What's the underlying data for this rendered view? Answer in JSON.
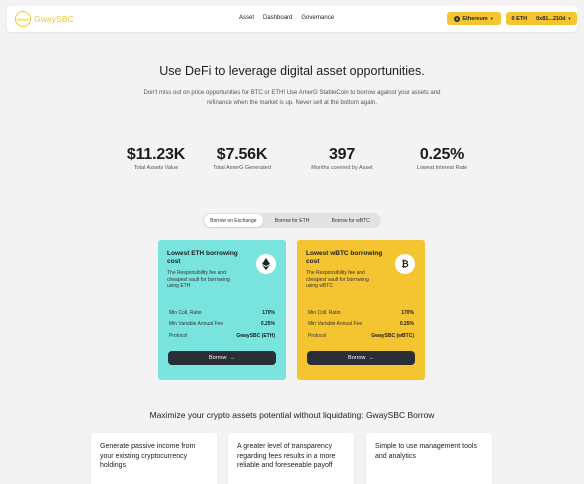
{
  "nav": {
    "logo_text": "GwaySBC",
    "logo_mark": "GWAY",
    "links": [
      "Asset",
      "Dashboard",
      "Governance"
    ],
    "network_label": "Ethereum",
    "balance_label": "0 ETH",
    "address_label": "0x81...210d"
  },
  "hero": {
    "title": "Use DeFi to leverage digital asset opportunities.",
    "subtitle": "Don't miss out on price opportunities for BTC or ETH! Use AmerG StableCoin to borrow against your assets and refinance when the market is up. Never sell at the bottom again."
  },
  "stats": [
    {
      "value": "$11.23K",
      "label": "Total Assets Value"
    },
    {
      "value": "$7.56K",
      "label": "Total AmerG Generated"
    },
    {
      "value": "397",
      "label": "Months covered by Asset"
    },
    {
      "value": "0.25%",
      "label": "Lowest Interest Rate"
    }
  ],
  "tabs": [
    "Borrow on Exchange",
    "Borrow for ETH",
    "Borrow for wBTC"
  ],
  "active_tab": 0,
  "cards": [
    {
      "title": "Lowest ETH borrowing cost",
      "description": "The Responsibility fee and cheapest vault for borrowing using ETH",
      "coin_icon": "ethereum-icon",
      "rows": [
        {
          "label": "Min Coll. Ratio",
          "value": "170%"
        },
        {
          "label": "Min Variable Annual Fee",
          "value": "0.25%"
        },
        {
          "label": "Protocol",
          "value": "GwaySBC (ETH)"
        }
      ],
      "button_label": "Borrow",
      "color": "#79e3de"
    },
    {
      "title": "Lowest wBTC borrowing cost",
      "description": "The Responsibility fee and cheapest vault for borrowing using wBTC",
      "coin_icon": "bitcoin-icon",
      "rows": [
        {
          "label": "Min Coll. Ratio",
          "value": "170%"
        },
        {
          "label": "Min Variable Annual Fee",
          "value": "0.25%"
        },
        {
          "label": "Protocol",
          "value": "GwaySBC (wBTC)"
        }
      ],
      "button_label": "Borrow",
      "color": "#f5c431"
    }
  ],
  "section": {
    "title": "Maximize your crypto assets potential without liquidating: GwaySBC Borrow",
    "features": [
      "Generate passive income from your existing cryptocurrency holdings",
      "A greater level of transparency regarding fees results in a more reliable and foreseeable payoff",
      "Simple to use management tools and analytics"
    ]
  },
  "colors": {
    "accent": "#f5c431",
    "teal": "#79e3de",
    "dark_button": "#2a2e36",
    "background": "#f3f3f3"
  }
}
